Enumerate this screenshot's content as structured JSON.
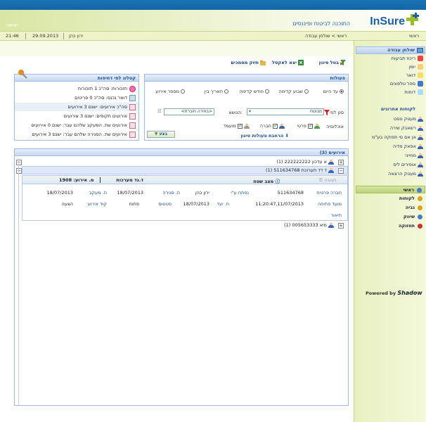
{
  "header": {
    "logout_label": "יציאה",
    "brand": "InSure",
    "tagline": "התוכנה לביטוח ופיננסים"
  },
  "statusbar": {
    "time": "21:46",
    "date": "29.09.2013",
    "user": "ירון כהן",
    "breadcrumb": "ראשי > שולחן עבודה",
    "home": "ראשי"
  },
  "toolbar": {
    "cancel_filter": "בטל סינון",
    "export_excel": "יצא לאקסל",
    "mark_filter": "תיוק מסמכים"
  },
  "actions_panel": {
    "title": "פעולות",
    "radios": [
      "עד היום",
      "שבוע קדימה",
      "חודש קדימה",
      "תאריך בין",
      "מספר אירוע"
    ],
    "filter_by_label": "סנן לפי",
    "filter_by_value": "מבוטח",
    "subject_label": "הנושא:",
    "subject_value": "<בחירה חוברת>",
    "population_label": "אוכלוסיה",
    "checks": [
      "פרטי",
      "חברה",
      "מועמד"
    ],
    "expand_label": "הרחבת פעולות סינון",
    "submit_label": "בצע"
  },
  "catalog_panel": {
    "title": "קטלוג לפי דחיפות",
    "rows": [
      "תזכורות: סה\"כ 1 תזכורות",
      "דואר נכנס: סה\"כ 0 פריטים",
      "סה\"כ אירועים: ישנם 3 אירועים",
      "אירועים תקופים: ישנם 3 אירועים",
      "אירועים שת. המעקב שלהם עבר: ישנם 0 אירועים",
      "אירועים שת. הסגירה שלהם עבר: ישנם 3 אירועים"
    ]
  },
  "events_panel": {
    "title": "אירועים (3)",
    "rows": [
      {
        "label": "א עדכון 222222222 (1)"
      },
      {
        "label": "ד דד תערוכת 511634768 (1)"
      },
      {
        "label": "מיא 005653333 (1)"
      }
    ],
    "detail": {
      "tab_event_no": "מ. אירוע: 1908",
      "tab_type": "ד.נד מערכות",
      "tab_status": "מצב שטח",
      "policy_label": "חברה פרטית",
      "policy_value": "511634768",
      "created_by_label": "נפתח ע\"י",
      "created_by_value": "ירון כהן",
      "close_date_label": "ת. סגירה",
      "close_date_value": "18/07/2013",
      "follow_label": "ת. מעקב",
      "follow_value": "18/07/2013",
      "open_time_label": "מועד פתיחה",
      "open_time_value": "11:20:47,11/07/2013",
      "due_label": "ת. יעד",
      "due_value": "18/07/2013",
      "status_label": "סטטוס",
      "status_value": "פתוח",
      "code_label": "קוד אירוע",
      "code_value": "הצעה",
      "desc_label": "תיאור"
    }
  },
  "sidebar": {
    "top_items": [
      "שולחן עבודה",
      "ריכוז תביעות",
      "יומן",
      "דואר",
      "ספר טלפונים",
      "דוחות"
    ],
    "clients_header": "לקוחות אחרונים",
    "clients": [
      "מעטק טסט",
      "רשאבק שירה",
      "אן אם סי תפוקה בע\"מ",
      "אפאק מדיה",
      "מחייני",
      "אופירים ליס",
      "מעטק הרצאה"
    ],
    "menu": [
      "ראשי",
      "לקוחות",
      "גביה",
      "שיווק",
      "תחזוקה"
    ]
  },
  "powered": {
    "prefix": "Powered by",
    "brand": "Shadow"
  },
  "colors": {
    "top_blue": "#1565a5",
    "accent_green": "#c8d58a",
    "link_blue": "#1a4f90"
  }
}
